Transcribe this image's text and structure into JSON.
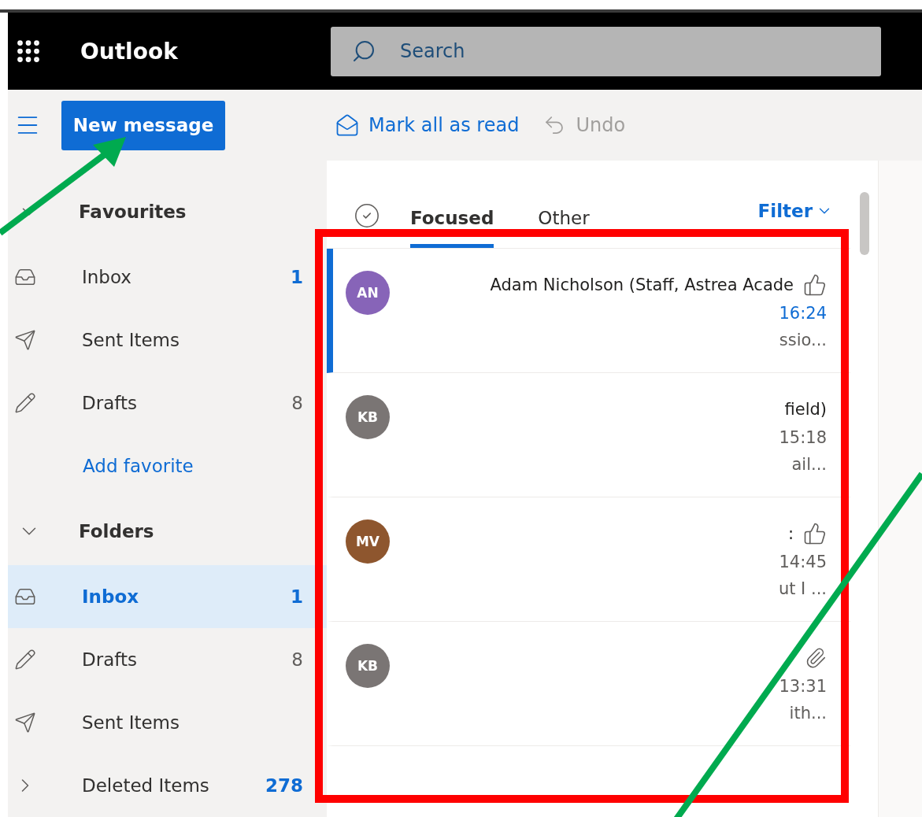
{
  "header": {
    "app_title": "Outlook",
    "search": {
      "placeholder": "Search"
    }
  },
  "toolbar": {
    "new_message": "New message",
    "actions": [
      {
        "kind": "mark_read",
        "label": "Mark all as read",
        "disabled": false
      },
      {
        "kind": "undo",
        "label": "Undo",
        "disabled": true
      }
    ]
  },
  "sidebar": {
    "sections": [
      {
        "title": "Favourites",
        "expanded": true,
        "items": [
          {
            "kind": "inbox",
            "label": "Inbox",
            "count": "1",
            "unread": true,
            "selected": false
          },
          {
            "kind": "sent",
            "label": "Sent Items",
            "selected": false
          },
          {
            "kind": "drafts",
            "label": "Drafts",
            "count": "8",
            "unread": false,
            "selected": false
          },
          {
            "kind": "link",
            "label": "Add favorite",
            "selected": false
          }
        ]
      },
      {
        "title": "Folders",
        "expanded": true,
        "items": [
          {
            "kind": "inbox",
            "label": "Inbox",
            "count": "1",
            "unread": true,
            "selected": true
          },
          {
            "kind": "drafts",
            "label": "Drafts",
            "count": "8",
            "unread": false,
            "selected": false
          },
          {
            "kind": "sent",
            "label": "Sent Items",
            "selected": false
          },
          {
            "kind": "folder",
            "label": "Deleted Items",
            "count": "278",
            "unread": true,
            "selected": false
          }
        ]
      }
    ]
  },
  "message_list": {
    "tabs": [
      {
        "label": "Focused",
        "selected": true
      },
      {
        "label": "Other",
        "selected": false
      }
    ],
    "filter": "Filter",
    "messages": [
      {
        "initials": "AN",
        "color": "#8764b8",
        "sender": "Adam Nicholson (Staff, Astrea Acade",
        "time": "16:24",
        "preview": "ssio...",
        "kind": "liked",
        "selected": true
      },
      {
        "initials": "KB",
        "color": "#7a7574",
        "sender": "field)",
        "time": "15:18",
        "preview": "ail...",
        "kind": "plain",
        "selected": false
      },
      {
        "initials": "MV",
        "color": "#8e562e",
        "sender": ":",
        "time": "14:45",
        "preview": "ut I ...",
        "kind": "liked",
        "selected": false
      },
      {
        "initials": "KB",
        "color": "#7a7574",
        "time": "13:31",
        "preview": "ith...",
        "kind": "attachment",
        "selected": false
      }
    ]
  }
}
